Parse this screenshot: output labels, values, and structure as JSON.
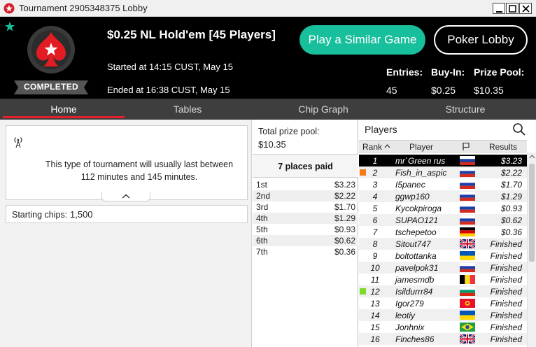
{
  "window": {
    "title": "Tournament 2905348375 Lobby"
  },
  "header": {
    "game_title": "$0.25 NL Hold'em [45 Players]",
    "status_badge": "COMPLETED",
    "started": "Started at 14:15 CUST, May 15",
    "ended": "Ended at 16:38 CUST, May 15",
    "similar_button": "Play a Similar Game",
    "lobby_button": "Poker Lobby",
    "stats": [
      {
        "label": "Entries:",
        "value": "45"
      },
      {
        "label": "Buy-In:",
        "value": "$0.25"
      },
      {
        "label": "Prize Pool:",
        "value": "$10.35"
      }
    ]
  },
  "tabs": [
    "Home",
    "Tables",
    "Chip Graph",
    "Structure"
  ],
  "active_tab": "Home",
  "home": {
    "info_line1": "This type of tournament will usually last between",
    "info_line2": "112 minutes and 145 minutes.",
    "starting_chips_label": "Starting chips:",
    "starting_chips_value": "1,500"
  },
  "prizes": {
    "total_label": "Total prize pool:",
    "total_value": "$10.35",
    "paid_label": "7 places paid",
    "rows": [
      {
        "place": "1st",
        "amount": "$3.23"
      },
      {
        "place": "2nd",
        "amount": "$2.22"
      },
      {
        "place": "3rd",
        "amount": "$1.70"
      },
      {
        "place": "4th",
        "amount": "$1.29"
      },
      {
        "place": "5th",
        "amount": "$0.93"
      },
      {
        "place": "6th",
        "amount": "$0.62"
      },
      {
        "place": "7th",
        "amount": "$0.36"
      }
    ]
  },
  "players": {
    "title": "Players",
    "columns": {
      "rank": "Rank",
      "player": "Player",
      "results": "Results"
    },
    "rows": [
      {
        "rank": "1",
        "name": "mr`Green rus",
        "flag": "ru",
        "result": "$3.23",
        "selected": true
      },
      {
        "rank": "2",
        "name": "Fish_in_aspic",
        "flag": "ru",
        "result": "$2.22",
        "marker": "#f07d1a"
      },
      {
        "rank": "3",
        "name": "I5panec",
        "flag": "ru",
        "result": "$1.70"
      },
      {
        "rank": "4",
        "name": "ggwp160",
        "flag": "ru",
        "result": "$1.29"
      },
      {
        "rank": "5",
        "name": "Kycokpiroga",
        "flag": "ru",
        "result": "$0.93"
      },
      {
        "rank": "6",
        "name": "SUPAO121",
        "flag": "ru",
        "result": "$0.62"
      },
      {
        "rank": "7",
        "name": "tschepetoo",
        "flag": "de",
        "result": "$0.36"
      },
      {
        "rank": "8",
        "name": "Sitout747",
        "flag": "gb",
        "result": "Finished"
      },
      {
        "rank": "9",
        "name": "boltottanka",
        "flag": "ua",
        "result": "Finished"
      },
      {
        "rank": "10",
        "name": "pavelpok31",
        "flag": "ru",
        "result": "Finished"
      },
      {
        "rank": "11",
        "name": "jamesmdb",
        "flag": "be",
        "result": "Finished"
      },
      {
        "rank": "12",
        "name": "Isildurrr84",
        "flag": "bg",
        "result": "Finished",
        "marker": "#7ddc2a"
      },
      {
        "rank": "13",
        "name": "Igor279",
        "flag": "kg",
        "result": "Finished"
      },
      {
        "rank": "14",
        "name": "leotiy",
        "flag": "ua",
        "result": "Finished"
      },
      {
        "rank": "15",
        "name": "Jonhnix",
        "flag": "br",
        "result": "Finished"
      },
      {
        "rank": "16",
        "name": "Finches86",
        "flag": "gb",
        "result": "Finished"
      }
    ]
  },
  "colors": {
    "accent_teal": "#18bf9c",
    "tab_underline_red": "#e1202b",
    "header_bg": "#000000"
  }
}
